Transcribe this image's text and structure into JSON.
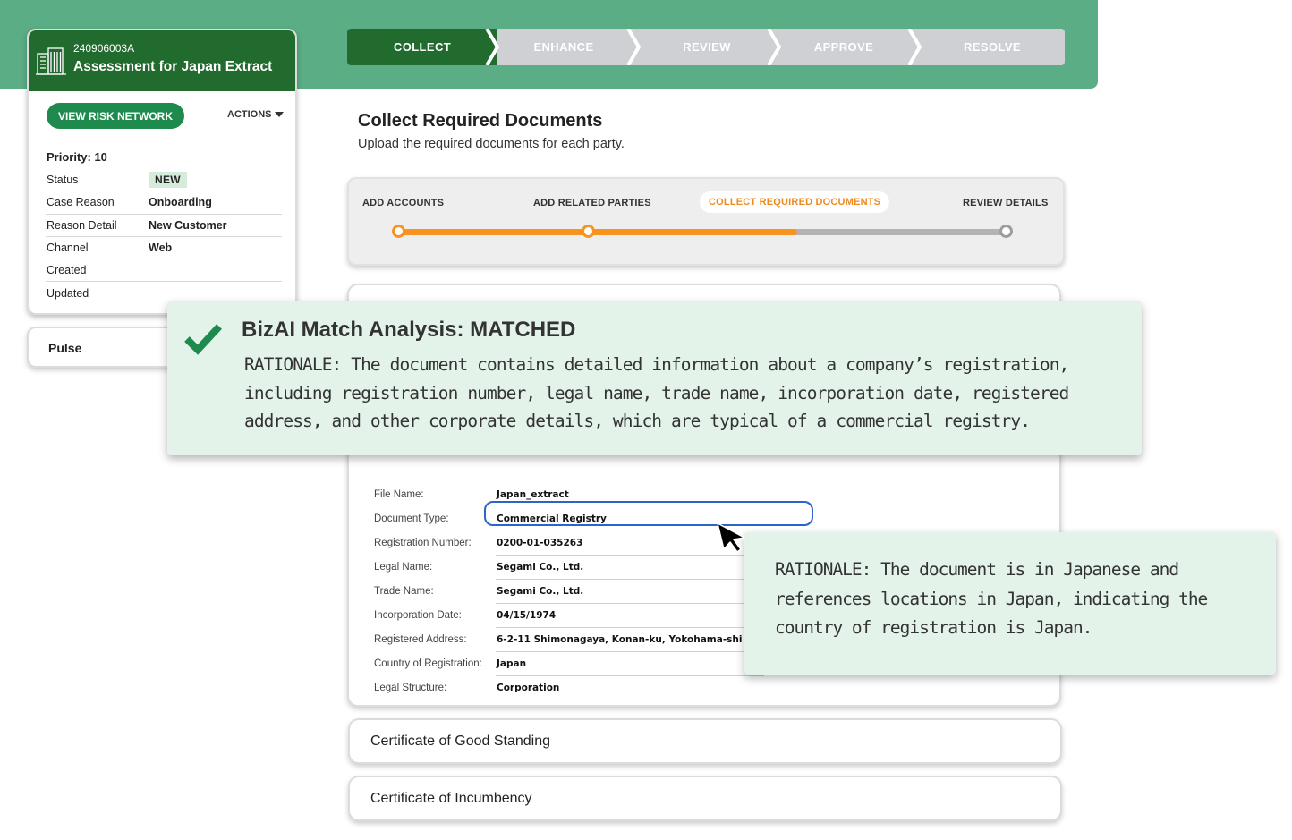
{
  "case": {
    "id": "240906003A",
    "title": "Assessment for Japan Extract",
    "risk_button": "VIEW RISK NETWORK",
    "actions_label": "ACTIONS",
    "priority": "Priority: 10",
    "properties": [
      {
        "label": "Status",
        "value": "NEW"
      },
      {
        "label": "Case Reason",
        "value": "Onboarding"
      },
      {
        "label": "Reason Detail",
        "value": "New Customer"
      },
      {
        "label": "Channel",
        "value": "Web"
      },
      {
        "label": "Created",
        "value": ""
      },
      {
        "label": "Updated",
        "value": ""
      }
    ]
  },
  "pulse": {
    "label": "Pulse"
  },
  "stages": [
    {
      "label": "COLLECT",
      "active": true
    },
    {
      "label": "ENHANCE",
      "active": false
    },
    {
      "label": "REVIEW",
      "active": false
    },
    {
      "label": "APPROVE",
      "active": false
    },
    {
      "label": "RESOLVE",
      "active": false
    }
  ],
  "page": {
    "title": "Collect Required Documents",
    "subtitle": "Upload the required documents for each party."
  },
  "stepper": {
    "steps": [
      {
        "label": "ADD ACCOUNTS",
        "state": "done"
      },
      {
        "label": "ADD RELATED PARTIES",
        "state": "done"
      },
      {
        "label": "COLLECT REQUIRED DOCUMENTS",
        "state": "current"
      },
      {
        "label": "REVIEW DETAILS",
        "state": "pending"
      }
    ]
  },
  "document": {
    "fields": [
      {
        "label": "File Name:",
        "value": "Japan_extract"
      },
      {
        "label": "Document Type:",
        "value": "Commercial Registry"
      },
      {
        "label": "Registration Number:",
        "value": "0200-01-035263"
      },
      {
        "label": "Legal Name:",
        "value": "Segami Co., Ltd."
      },
      {
        "label": "Trade Name:",
        "value": "Segami Co., Ltd."
      },
      {
        "label": "Incorporation Date:",
        "value": "04/15/1974"
      },
      {
        "label": "Registered Address:",
        "value": "6-2-11 Shimonagaya, Konan-ku, Yokohama-shi"
      },
      {
        "label": "Country of Registration:",
        "value": "Japan"
      },
      {
        "label": "Legal Structure:",
        "value": "Corporation"
      }
    ]
  },
  "certificates": [
    {
      "label": "Certificate of Good Standing"
    },
    {
      "label": "Certificate of Incumbency"
    }
  ],
  "bizai": {
    "title": "BizAI Match Analysis: MATCHED",
    "rationale": "RATIONALE: The document contains detailed information about a company’s registration, including registration number, legal name, trade name, incorporation date, registered address, and other corporate details, which are typical of a commercial registry."
  },
  "country_rationale": {
    "text": "RATIONALE: The document is in Japanese and references locations in Japan, indicating the country of registration is Japan."
  },
  "colors": {
    "brand_green": "#226b2e",
    "band_green": "#5aad85",
    "button_green": "#1e8a4e",
    "accent_orange": "#f7941d",
    "callout_bg": "#e3f3ea",
    "focus_blue": "#2d64c7"
  }
}
